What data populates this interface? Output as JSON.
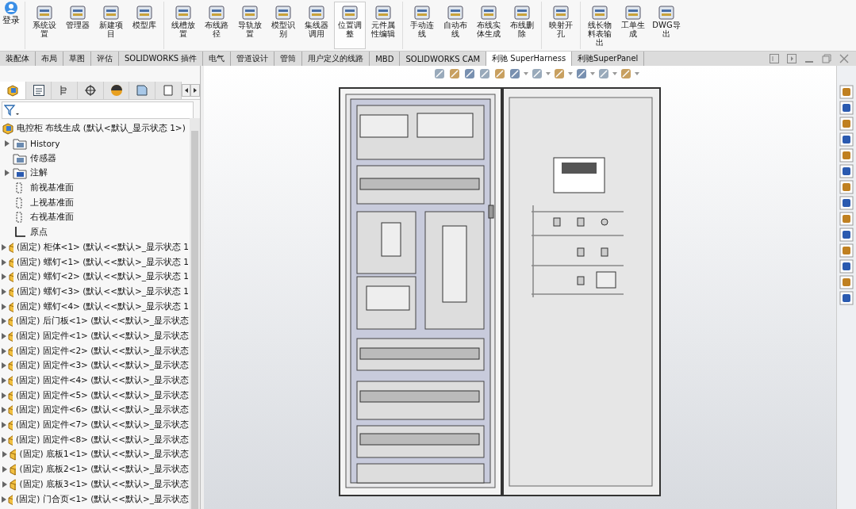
{
  "ribbon": {
    "login": {
      "label": "登录"
    },
    "groups": [
      [
        {
          "label": "系统设置",
          "selected": false
        },
        {
          "label": "管理器",
          "selected": false
        },
        {
          "label": "新建项目",
          "selected": false
        },
        {
          "label": "模型库",
          "selected": false
        }
      ],
      [
        {
          "label": "线槽放置",
          "selected": false
        },
        {
          "label": "布线路径",
          "selected": false
        },
        {
          "label": "导轨放置",
          "selected": false
        },
        {
          "label": "模型识别",
          "selected": false
        },
        {
          "label": "集线器调用",
          "selected": false
        },
        {
          "label": "位置调整",
          "selected": true
        },
        {
          "label": "元件属性编辑",
          "selected": false
        }
      ],
      [
        {
          "label": "手动连线",
          "selected": false
        },
        {
          "label": "自动布线",
          "selected": false
        },
        {
          "label": "布线实体生成",
          "selected": false
        },
        {
          "label": "布线删除",
          "selected": false
        }
      ],
      [
        {
          "label": "映射开孔",
          "selected": false
        }
      ],
      [
        {
          "label": "线长物料表输出",
          "selected": false
        },
        {
          "label": "工单生成",
          "selected": false
        },
        {
          "label": "DWG导出",
          "selected": false
        }
      ]
    ]
  },
  "tabs": [
    {
      "label": "装配体",
      "selected": false
    },
    {
      "label": "布局",
      "selected": false
    },
    {
      "label": "草图",
      "selected": false
    },
    {
      "label": "评估",
      "selected": false
    },
    {
      "label": "SOLIDWORKS 插件",
      "selected": false
    },
    {
      "label": "电气",
      "selected": false
    },
    {
      "label": "管道设计",
      "selected": false
    },
    {
      "label": "管筒",
      "selected": false
    },
    {
      "label": "用户定义的线路",
      "selected": false
    },
    {
      "label": "MBD",
      "selected": false
    },
    {
      "label": "SOLIDWORKS CAM",
      "selected": false
    },
    {
      "label": "利驰 SuperHarness",
      "selected": true
    },
    {
      "label": "利驰SuperPanel",
      "selected": false
    }
  ],
  "tree": {
    "root": "电控柜 布线生成 (默认<默认_显示状态 1>)",
    "items": [
      {
        "kind": "history",
        "label": "History",
        "has_children": true
      },
      {
        "kind": "sensor",
        "label": "传感器",
        "has_children": false
      },
      {
        "kind": "annotation",
        "label": "注解",
        "has_children": true
      },
      {
        "kind": "plane",
        "label": "前视基准面",
        "has_children": false
      },
      {
        "kind": "plane",
        "label": "上视基准面",
        "has_children": false
      },
      {
        "kind": "plane",
        "label": "右视基准面",
        "has_children": false
      },
      {
        "kind": "origin",
        "label": "原点",
        "has_children": false
      },
      {
        "kind": "part",
        "label": "(固定) 柜体<1> (默认<<默认>_显示状态 1",
        "has_children": true
      },
      {
        "kind": "part",
        "label": "(固定) 螺钉<1> (默认<<默认>_显示状态 1",
        "has_children": true
      },
      {
        "kind": "part",
        "label": "(固定) 螺钉<2> (默认<<默认>_显示状态 1",
        "has_children": true
      },
      {
        "kind": "part",
        "label": "(固定) 螺钉<3> (默认<<默认>_显示状态 1",
        "has_children": true
      },
      {
        "kind": "part",
        "label": "(固定) 螺钉<4> (默认<<默认>_显示状态 1",
        "has_children": true
      },
      {
        "kind": "part",
        "label": "(固定) 后门板<1> (默认<<默认>_显示状态",
        "has_children": true
      },
      {
        "kind": "part",
        "label": "(固定) 固定件<1> (默认<<默认>_显示状态",
        "has_children": true
      },
      {
        "kind": "part",
        "label": "(固定) 固定件<2> (默认<<默认>_显示状态",
        "has_children": true
      },
      {
        "kind": "part",
        "label": "(固定) 固定件<3> (默认<<默认>_显示状态",
        "has_children": true
      },
      {
        "kind": "part",
        "label": "(固定) 固定件<4> (默认<<默认>_显示状态",
        "has_children": true
      },
      {
        "kind": "part",
        "label": "(固定) 固定件<5> (默认<<默认>_显示状态",
        "has_children": true
      },
      {
        "kind": "part",
        "label": "(固定) 固定件<6> (默认<<默认>_显示状态",
        "has_children": true
      },
      {
        "kind": "part",
        "label": "(固定) 固定件<7> (默认<<默认>_显示状态",
        "has_children": true
      },
      {
        "kind": "part",
        "label": "(固定) 固定件<8> (默认<<默认>_显示状态",
        "has_children": true
      },
      {
        "kind": "part",
        "label": "(固定) 底板1<1> (默认<<默认>_显示状态",
        "has_children": true
      },
      {
        "kind": "part",
        "label": "(固定) 底板2<1> (默认<<默认>_显示状态",
        "has_children": true
      },
      {
        "kind": "part",
        "label": "(固定) 底板3<1> (默认<<默认>_显示状态",
        "has_children": true
      },
      {
        "kind": "part",
        "label": "(固定) 门合页<1> (默认<<默认>_显示状态",
        "has_children": true
      }
    ]
  }
}
